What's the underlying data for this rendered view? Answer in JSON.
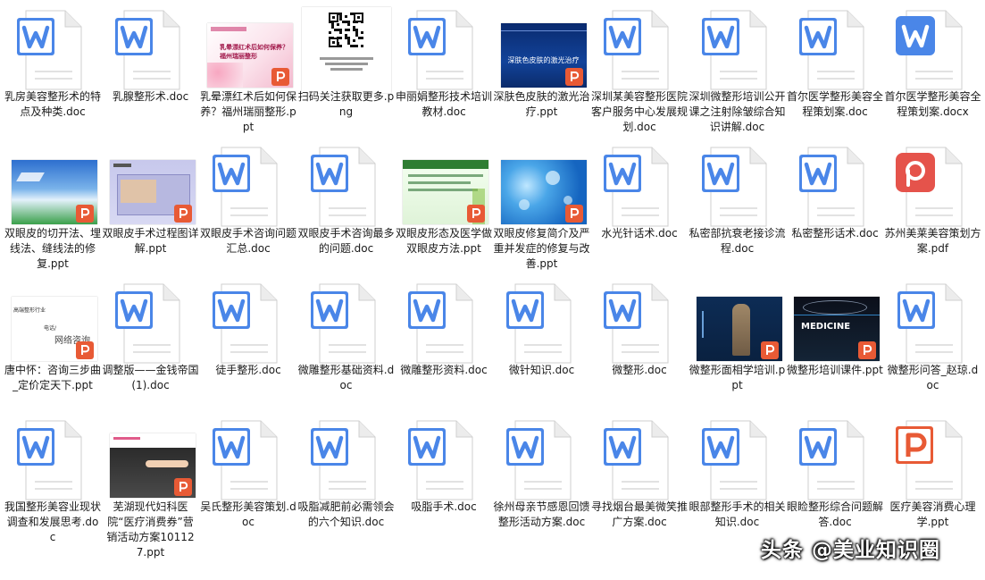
{
  "files": [
    {
      "name": "乳房美容整形术的特点及种类.doc",
      "type": "doc"
    },
    {
      "name": "乳腺整形术.doc",
      "type": "doc"
    },
    {
      "name": "乳晕漂红术后如何保养？福州瑞丽整形.ppt",
      "type": "ppt",
      "thumb": "pink"
    },
    {
      "name": "扫码关注获取更多.png",
      "type": "png"
    },
    {
      "name": "申丽娟整形技术培训教材.doc",
      "type": "doc"
    },
    {
      "name": "深肤色皮肤的激光治疗.ppt",
      "type": "ppt",
      "thumb": "navy"
    },
    {
      "name": "深圳某美容整形医院客户服务中心发展规划.doc",
      "type": "doc"
    },
    {
      "name": "深圳微整形培训公开课之注射除皱综合知识讲解.doc",
      "type": "doc"
    },
    {
      "name": "首尔医学整形美容全程策划案.doc",
      "type": "doc"
    },
    {
      "name": "首尔医学整形美容全程策划案.docx",
      "type": "docx"
    },
    {
      "name": "双眼皮的切开法、埋线法、缝线法的修复.ppt",
      "type": "ppt",
      "thumb": "sky"
    },
    {
      "name": "双眼皮手术过程图详解.ppt",
      "type": "ppt",
      "thumb": "lavender"
    },
    {
      "name": "双眼皮手术咨询问题汇总.doc",
      "type": "doc"
    },
    {
      "name": "双眼皮手术咨询最多的问题.doc",
      "type": "doc"
    },
    {
      "name": "双眼皮形态及医学做双眼皮方法.ppt",
      "type": "ppt",
      "thumb": "green"
    },
    {
      "name": "双眼皮修复简介及严重并发症的修复与改善.ppt",
      "type": "ppt",
      "thumb": "bokeh"
    },
    {
      "name": "水光针话术.doc",
      "type": "doc"
    },
    {
      "name": "私密部抗衰老接诊流程.doc",
      "type": "doc"
    },
    {
      "name": "私密整形话术.doc",
      "type": "doc"
    },
    {
      "name": "苏州美莱美容策划方案.pdf",
      "type": "pdf"
    },
    {
      "name": "唐中怀：咨询三步曲_定价定天下.ppt",
      "type": "ppt",
      "thumb": "script"
    },
    {
      "name": "调整版——金钱帝国(1).doc",
      "type": "doc"
    },
    {
      "name": "徒手整形.doc",
      "type": "doc"
    },
    {
      "name": "微雕整形基础资料.doc",
      "type": "doc"
    },
    {
      "name": "微雕整形资料.doc",
      "type": "doc"
    },
    {
      "name": "微针知识.doc",
      "type": "doc"
    },
    {
      "name": "微整形.doc",
      "type": "doc"
    },
    {
      "name": "微整形面相学培训.ppt",
      "type": "ppt",
      "thumb": "statue"
    },
    {
      "name": "微整形培训课件.ppt",
      "type": "ppt",
      "thumb": "medicine"
    },
    {
      "name": "微整形问答_赵琼.doc",
      "type": "doc"
    },
    {
      "name": "我国整形美容业现状调查和发展思考.doc",
      "type": "doc"
    },
    {
      "name": "芜湖现代妇科医院“医疗消费券”营销活动方案101127.ppt",
      "type": "ppt",
      "thumb": "hand"
    },
    {
      "name": "吴氏整形美容策划.doc",
      "type": "doc"
    },
    {
      "name": "吸脂减肥前必需领会的六个知识.doc",
      "type": "doc"
    },
    {
      "name": "吸脂手术.doc",
      "type": "doc"
    },
    {
      "name": "徐州母亲节感恩回馈整形活动方案.doc",
      "type": "doc"
    },
    {
      "name": "寻找烟台最美微笑推广方案.doc",
      "type": "doc"
    },
    {
      "name": "眼部整形手术的相关知识.doc",
      "type": "doc"
    },
    {
      "name": "眼睑整形综合问题解答.doc",
      "type": "doc"
    },
    {
      "name": "医疗美容消费心理学.ppt",
      "type": "ppt-icon"
    }
  ],
  "slide_text": {
    "pink": "乳晕漂红术后如何保养？福州瑞丽整形",
    "navy": "深肤色皮肤的激光治疗",
    "medicine": "MEDICINE",
    "script_l1": "高端整形行业",
    "script_l2": "电话/",
    "script_l3": "网络咨询"
  },
  "watermark": "头条 @美业知识圈",
  "colors": {
    "word_blue": "#4a86e8",
    "ppt_orange": "#e85a35",
    "pdf_red": "#e5534b"
  }
}
